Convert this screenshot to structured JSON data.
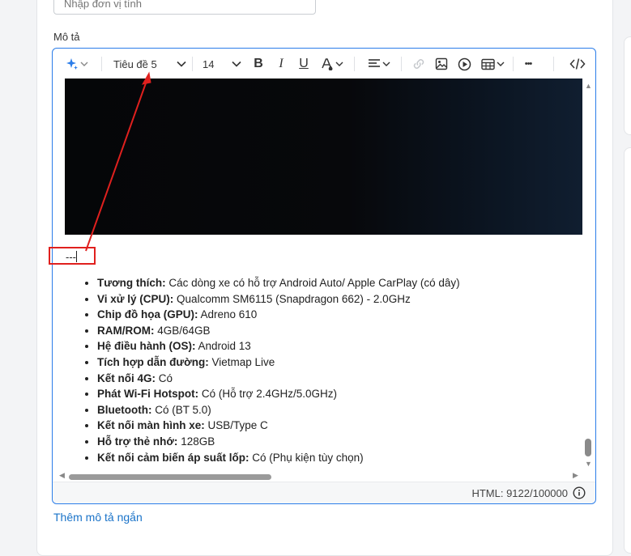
{
  "unit_field": {
    "placeholder": "Nhập đơn vị tính"
  },
  "description_label": "Mô tả",
  "toolbar": {
    "block_format": "Tiêu đề 5",
    "font_size": "14",
    "bold": "B",
    "italic": "I",
    "underline": "U",
    "more": "•••",
    "source": "</>"
  },
  "content": {
    "dashes": "---",
    "specs": [
      {
        "key": "Tương thích:",
        "value": " Các dòng xe có hỗ trợ Android Auto/ Apple CarPlay (có dây)"
      },
      {
        "key": "Vi xử lý (CPU):",
        "value": " Qualcomm SM6115 (Snapdragon 662) - 2.0GHz"
      },
      {
        "key": "Chip đồ họa (GPU):",
        "value": " Adreno 610"
      },
      {
        "key": "RAM/ROM:",
        "value": " 4GB/64GB"
      },
      {
        "key": "Hệ điều hành (OS):",
        "value": " Android 13"
      },
      {
        "key": "Tích hợp dẫn đường:",
        "value": " Vietmap Live"
      },
      {
        "key": "Kết nối 4G:",
        "value": " Có"
      },
      {
        "key": "Phát Wi-Fi Hotspot:",
        "value": " Có (Hỗ trợ 2.4GHz/5.0GHz)"
      },
      {
        "key": "Bluetooth:",
        "value": " Có (BT 5.0)"
      },
      {
        "key": "Kết nối màn hình xe:",
        "value": " USB/Type C"
      },
      {
        "key": "Hỗ trợ thẻ nhớ:",
        "value": " 128GB"
      },
      {
        "key": "Kết nối cảm biến áp suất lốp:",
        "value": " Có (Phụ kiện tùy chọn)"
      }
    ]
  },
  "status": {
    "html_count": "HTML: 9122/100000"
  },
  "short_description_link": "Thêm mô tả ngắn",
  "colors": {
    "accent": "#2b7de9",
    "link": "#1a73c9",
    "annotation": "#e0201e"
  },
  "icons": [
    "ai-sparkle-icon",
    "chevron-down-icon",
    "text-color-icon",
    "align-icon",
    "link-icon",
    "image-icon",
    "video-icon",
    "table-icon",
    "source-code-icon",
    "info-icon"
  ]
}
